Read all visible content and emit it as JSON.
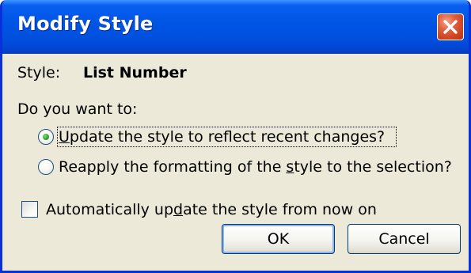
{
  "window": {
    "title": "Modify Style"
  },
  "style_row": {
    "label": "Style:",
    "value": "List Number"
  },
  "question": "Do you want to:",
  "options": [
    {
      "pre": "",
      "mnemonic": "U",
      "post": "pdate the style to reflect recent changes?",
      "selected": true
    },
    {
      "pre": "Reapply the formatting of the ",
      "mnemonic": "s",
      "post": "tyle to the selection?",
      "selected": false
    }
  ],
  "auto_update": {
    "pre": "Automatically up",
    "mnemonic": "d",
    "post": "ate the style from now on",
    "checked": false
  },
  "buttons": {
    "ok": "OK",
    "cancel": "Cancel"
  },
  "colors": {
    "titlebar": "#0054e3",
    "frame": "#0831d9",
    "close": "#e2603e",
    "dialog_bg": "#ece9d8"
  },
  "icons": {
    "close": "close-icon"
  }
}
